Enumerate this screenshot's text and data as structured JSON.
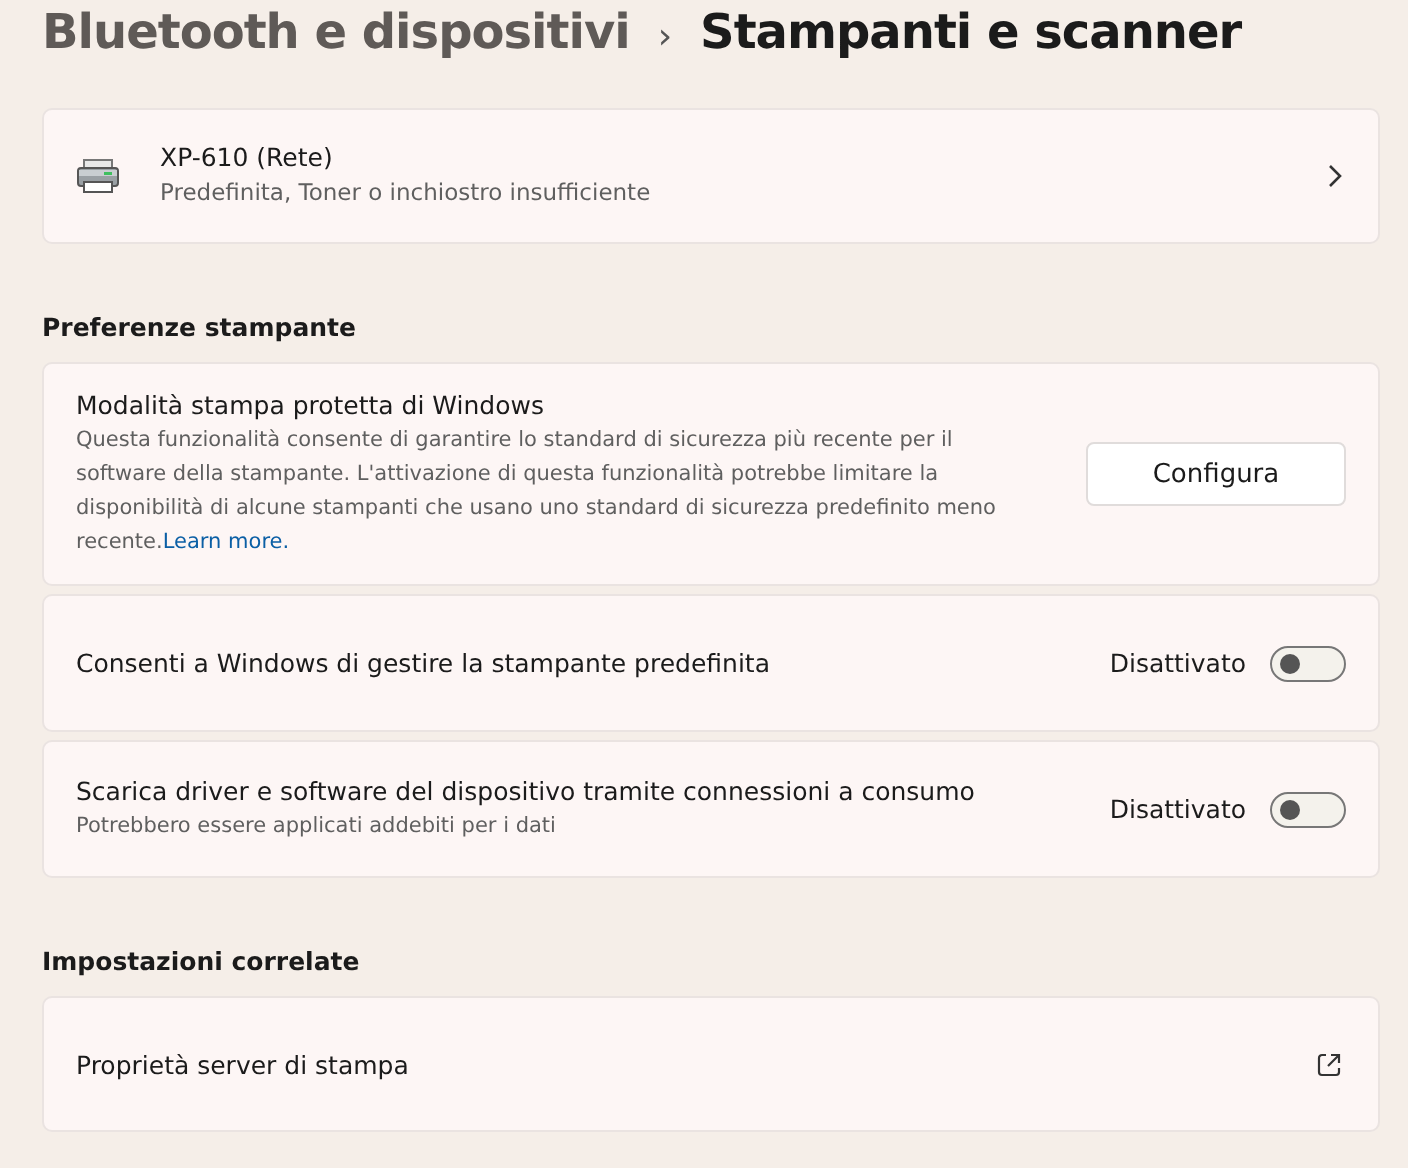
{
  "breadcrumb": [
    {
      "label": "Bluetooth e dispositivi",
      "current": false
    },
    {
      "label": "Stampanti e scanner",
      "current": true
    }
  ],
  "separator": "›",
  "printer": {
    "name": "XP-610 (Rete)",
    "status": "Predefinita, Toner o inchiostro insufficiente"
  },
  "sections": [
    {
      "heading": "Preferenze stampante",
      "items": [
        {
          "kind": "button",
          "title": "Modalità stampa protetta di Windows",
          "description": "Questa funzionalità consente di garantire lo standard di sicurezza più recente per il software della stampante. L'attivazione di questa funzionalità potrebbe limitare la disponibilità di alcune stampanti che usano uno standard di sicurezza predefinito meno recente.",
          "link": "Learn more.",
          "button": "Configura"
        },
        {
          "kind": "toggle",
          "title": "Consenti a Windows di gestire la stampante predefinita",
          "state_label": "Disattivato",
          "on": false
        },
        {
          "kind": "toggle",
          "title": "Scarica driver e software del dispositivo tramite connessioni a consumo",
          "description": "Potrebbero essere applicati addebiti per i dati",
          "state_label": "Disattivato",
          "on": false
        }
      ]
    },
    {
      "heading": "Impostazioni correlate",
      "items": [
        {
          "kind": "external",
          "title": "Proprietà server di stampa"
        }
      ]
    }
  ]
}
